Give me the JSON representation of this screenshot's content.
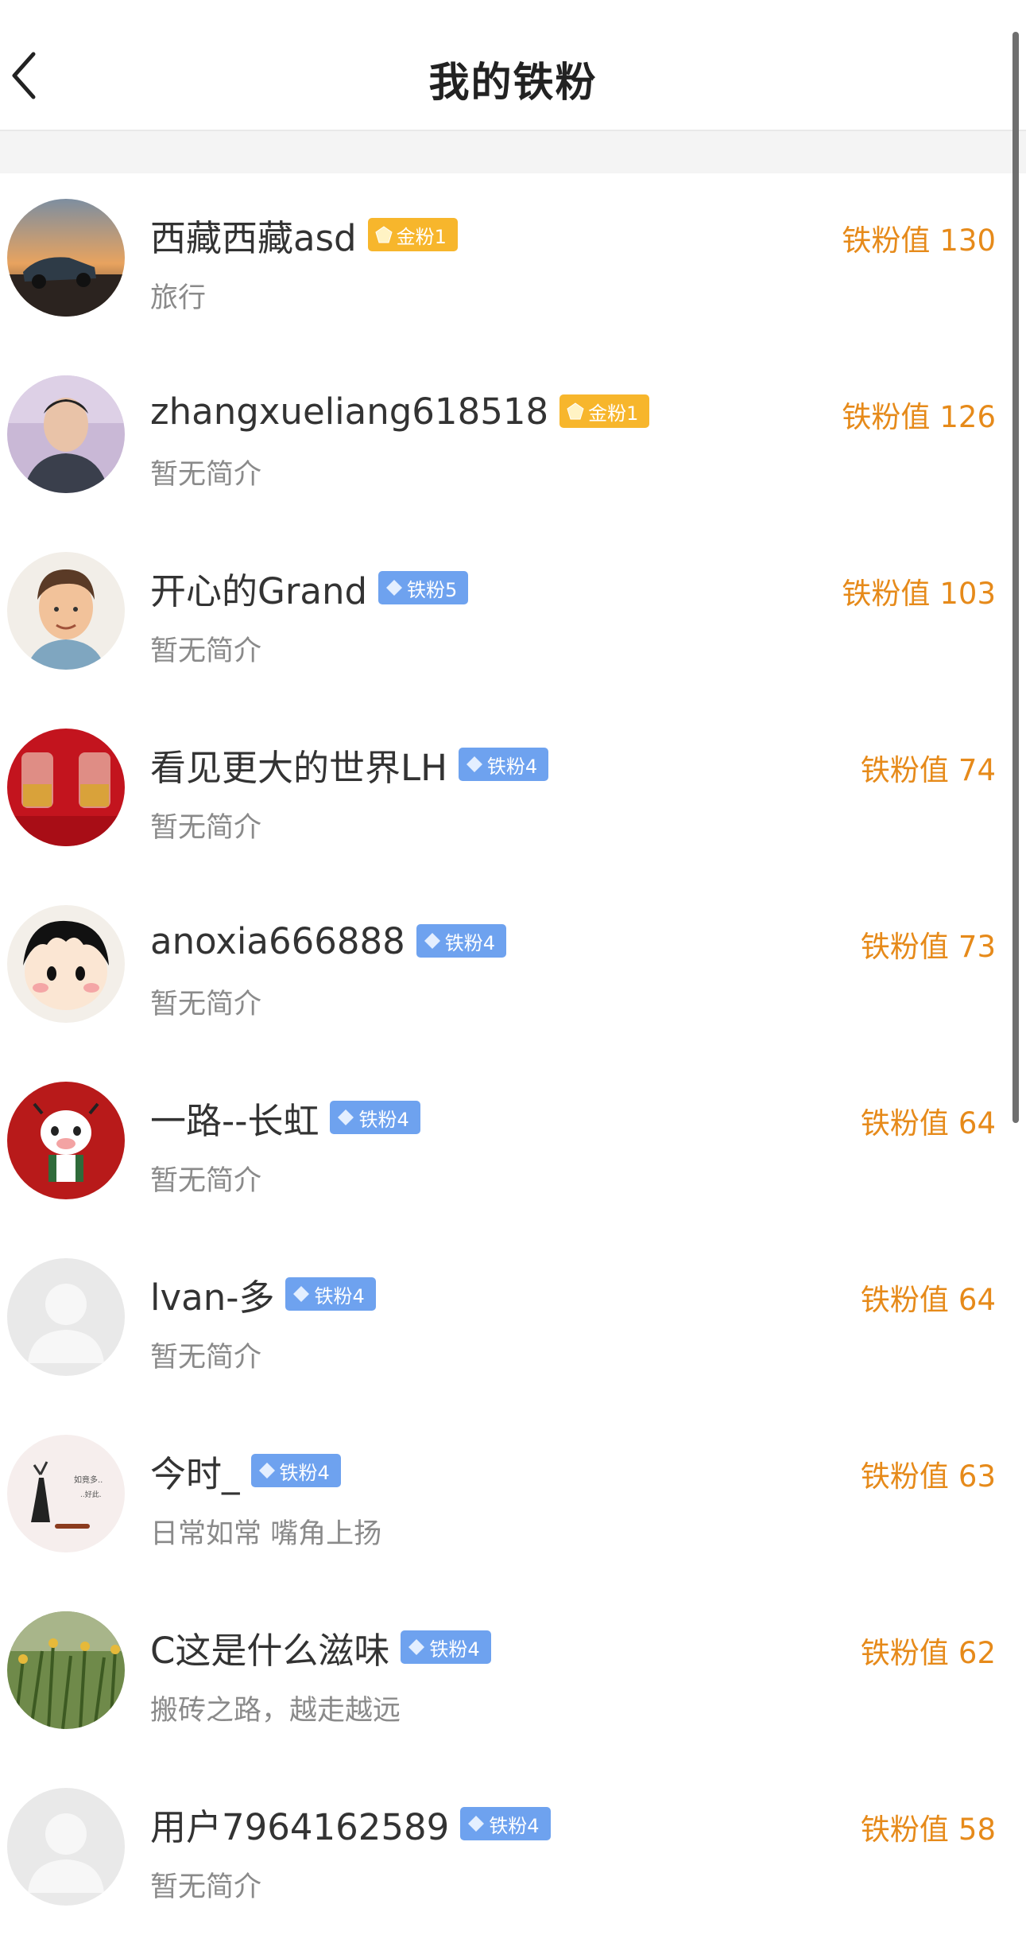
{
  "header": {
    "title": "我的铁粉"
  },
  "colors": {
    "accent": "#e68a1a",
    "gold_badge": "#f7b62c",
    "iron_badge": "#6ea2ef"
  },
  "score_label": "铁粉值",
  "fans": [
    {
      "name": "西藏西藏asd",
      "badge_type": "gold",
      "badge_text": "金粉1",
      "bio": "旅行",
      "score": "130"
    },
    {
      "name": "zhangxueliang618518",
      "badge_type": "gold",
      "badge_text": "金粉1",
      "bio": "暂无简介",
      "score": "126"
    },
    {
      "name": "开心的Grand",
      "badge_type": "iron",
      "badge_text": "铁粉5",
      "bio": "暂无简介",
      "score": "103"
    },
    {
      "name": "看见更大的世界LH",
      "badge_type": "iron",
      "badge_text": "铁粉4",
      "bio": "暂无简介",
      "score": "74"
    },
    {
      "name": "anoxia666888",
      "badge_type": "iron",
      "badge_text": "铁粉4",
      "bio": "暂无简介",
      "score": "73"
    },
    {
      "name": "一路--长虹",
      "badge_type": "iron",
      "badge_text": "铁粉4",
      "bio": "暂无简介",
      "score": "64"
    },
    {
      "name": "lvan-多",
      "badge_type": "iron",
      "badge_text": "铁粉4",
      "bio": "暂无简介",
      "score": "64"
    },
    {
      "name": "今时_",
      "badge_type": "iron",
      "badge_text": "铁粉4",
      "bio": "日常如常 嘴角上扬",
      "score": "63"
    },
    {
      "name": "C这是什么滋味",
      "badge_type": "iron",
      "badge_text": "铁粉4",
      "bio": "搬砖之路，越走越远",
      "score": "62"
    },
    {
      "name": "用户7964162589",
      "badge_type": "iron",
      "badge_text": "铁粉4",
      "bio": "暂无简介",
      "score": "58"
    }
  ]
}
